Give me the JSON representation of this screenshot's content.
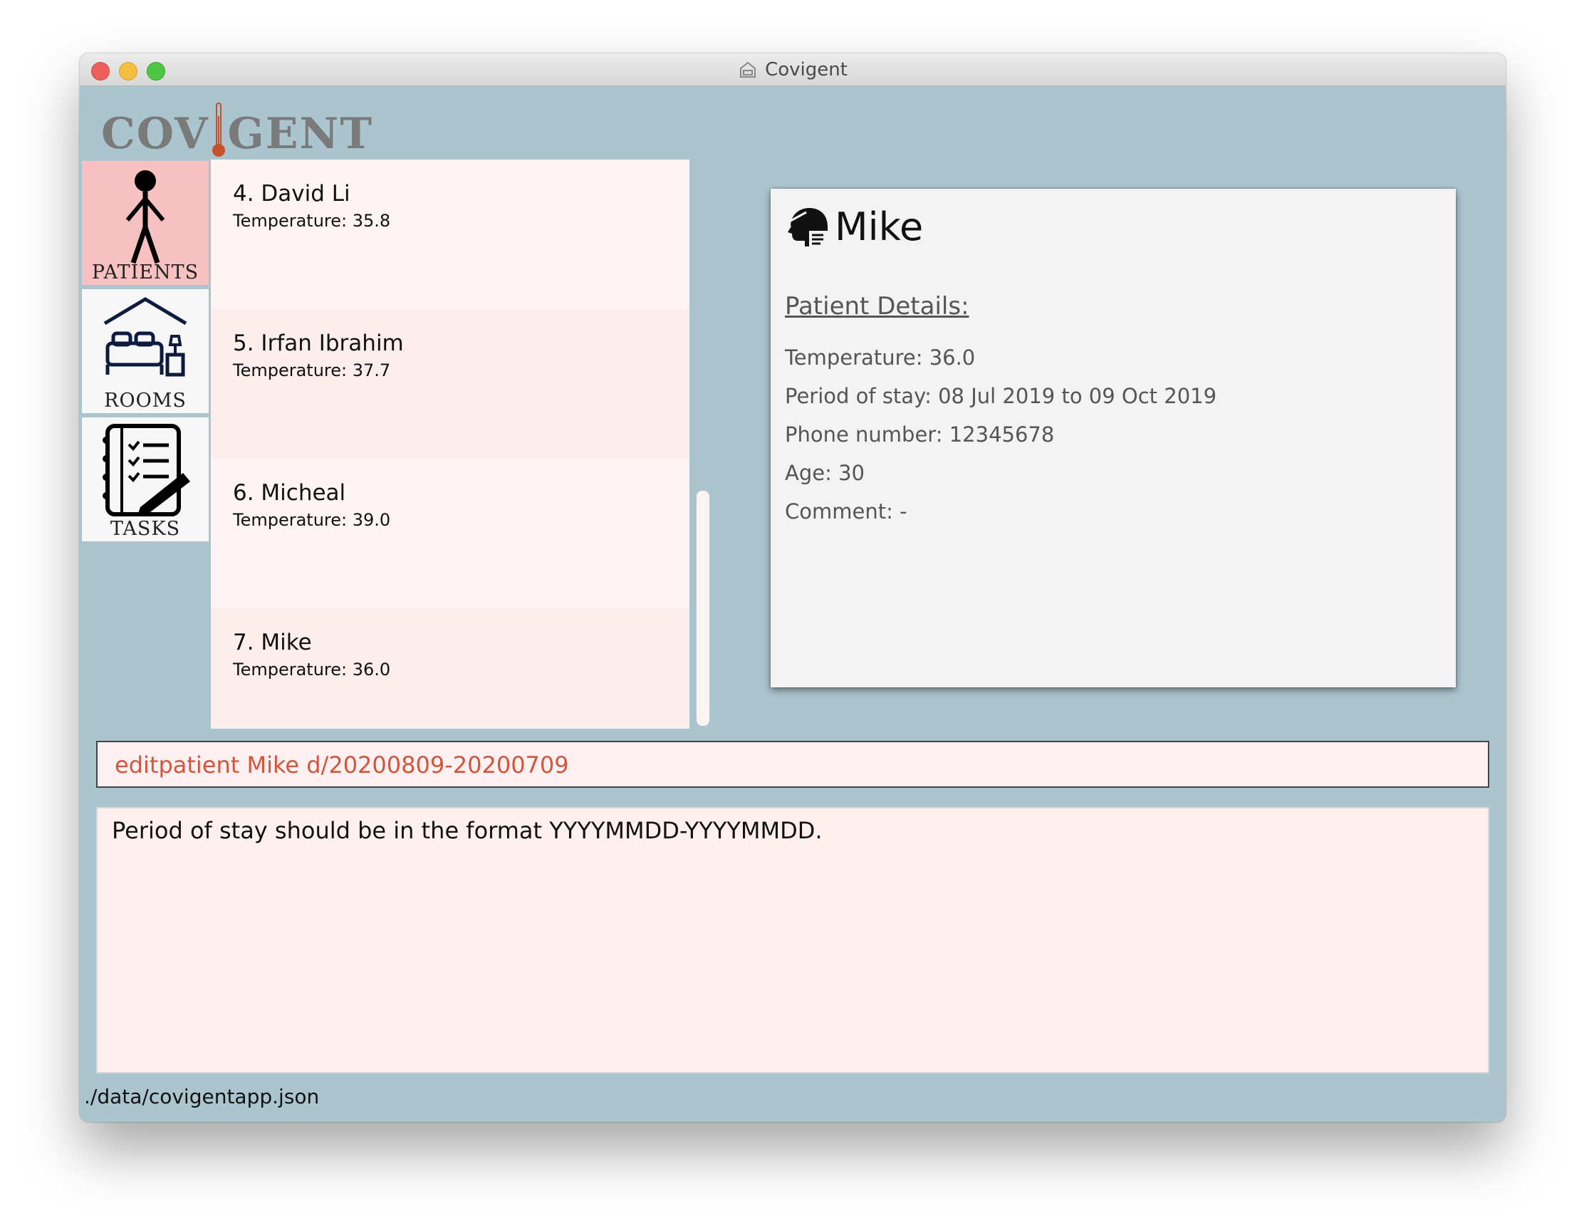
{
  "window": {
    "title": "Covigent"
  },
  "logo": {
    "left": "COV",
    "right": "GENT",
    "accent_color": "#c8502a"
  },
  "nav": [
    {
      "label": "PATIENTS",
      "icon": "person-icon",
      "active": true
    },
    {
      "label": "ROOMS",
      "icon": "bed-icon",
      "active": false
    },
    {
      "label": "TASKS",
      "icon": "checklist-icon",
      "active": false
    }
  ],
  "patients": [
    {
      "name": "4.  David Li",
      "temperature": "Temperature: 35.8"
    },
    {
      "name": "5.  Irfan Ibrahim",
      "temperature": "Temperature: 37.7"
    },
    {
      "name": "6.  Micheal",
      "temperature": "Temperature: 39.0"
    },
    {
      "name": "7.  Mike",
      "temperature": "Temperature: 36.0"
    }
  ],
  "detail": {
    "icon": "patient-head-icon",
    "name": "Mike",
    "section_title": "Patient Details:",
    "temperature": "Temperature: 36.0",
    "period": "Period of stay: 08 Jul 2019 to 09 Oct 2019",
    "phone": "Phone number: 12345678",
    "age": "Age: 30",
    "comment": "Comment: -"
  },
  "command": {
    "value": "editpatient Mike d/20200809-20200709"
  },
  "result": {
    "message": "Period of stay should be in the format YYYYMMDD-YYYYMMDD."
  },
  "status": {
    "path": "./data/covigentapp.json"
  },
  "colors": {
    "background": "#abc5cf",
    "active_nav": "#f8c1c1",
    "command_text": "#d3553b"
  }
}
